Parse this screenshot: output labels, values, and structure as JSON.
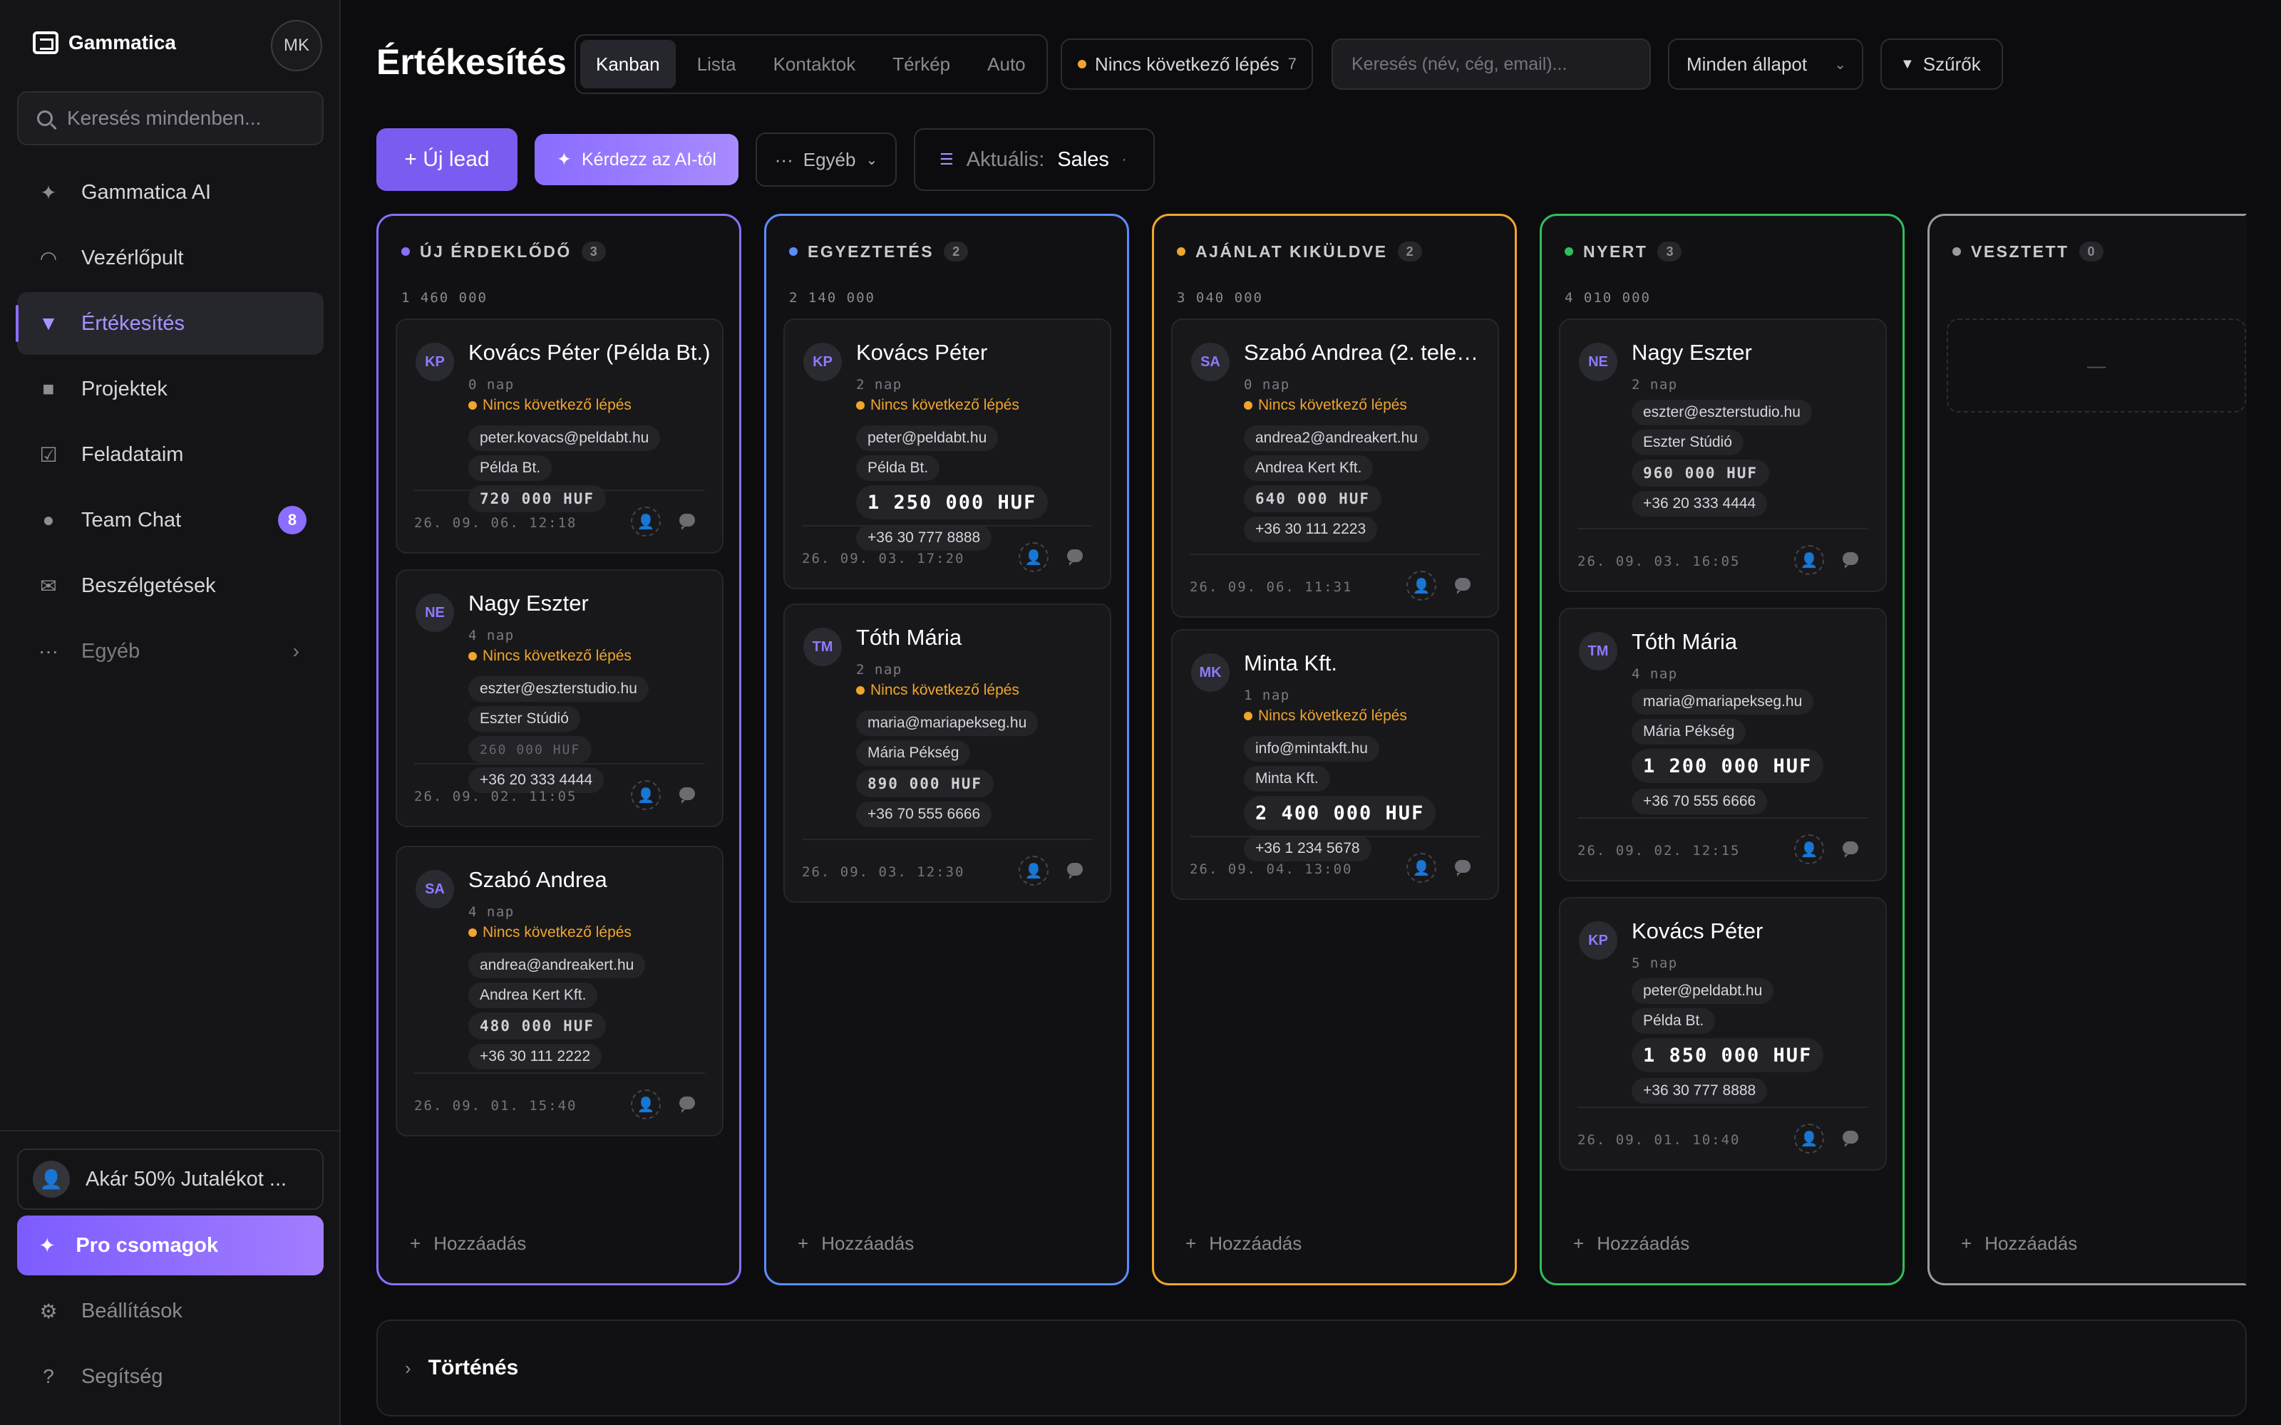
{
  "brand": {
    "name": "Gammatica",
    "user_initials": "MK"
  },
  "sidebar": {
    "search_placeholder": "Keresés mindenben...",
    "items": [
      {
        "label": "Gammatica AI",
        "icon": "sparkle-icon"
      },
      {
        "label": "Vezérlőpult",
        "icon": "dashboard-icon"
      },
      {
        "label": "Értékesítés",
        "icon": "funnel-icon",
        "active": true
      },
      {
        "label": "Projektek",
        "icon": "folder-icon"
      },
      {
        "label": "Feladataim",
        "icon": "checkbox-icon"
      },
      {
        "label": "Team Chat",
        "icon": "chat-icon",
        "badge": "8"
      },
      {
        "label": "Beszélgetések",
        "icon": "mail-icon"
      },
      {
        "label": "Egyéb",
        "icon": "more-icon"
      }
    ],
    "promo": "Akár 50% Jutalékot ...",
    "pro_label": "Pro csomagok",
    "settings_label": "Beállítások",
    "help_label": "Segítség"
  },
  "header": {
    "title": "Értékesítés",
    "tabs": [
      "Kanban",
      "Lista",
      "Kontaktok",
      "Térkép",
      "Auto"
    ],
    "next_step_filter": {
      "label": "Nincs következő lépés",
      "count": "7"
    },
    "search_placeholder": "Keresés (név, cég, email)...",
    "status_select": "Minden állapot",
    "filters_label": "Szűrők"
  },
  "actions": {
    "new_lead": "+ Új lead",
    "ask_ai": "Kérdezz az AI-tól",
    "other": "Egyéb",
    "current_label": "Aktuális:",
    "current_value": "Sales"
  },
  "columns": [
    {
      "title": "ÚJ ÉRDEKLŐDŐ",
      "count": "3",
      "sum": "1 460 000",
      "color": "#8b6dff",
      "cards": [
        {
          "initials": "KP",
          "name": "Kovács Péter (Példa Bt.)",
          "days": "0 nap",
          "next": "Nincs következő lépés",
          "email": "peter.kovacs@peldabt.hu",
          "company": "Példa Bt.",
          "amount": "720 000 HUF",
          "date": "26. 09. 06. 12:18"
        },
        {
          "initials": "NE",
          "name": "Nagy Eszter",
          "days": "4 nap",
          "next": "Nincs következő lépés",
          "email": "eszter@eszterstudio.hu",
          "company": "Eszter Stúdió",
          "amount": "260 000 HUF",
          "phone": "+36 20 333 4444",
          "date": "26. 09. 02. 11:05"
        },
        {
          "initials": "SA",
          "name": "Szabó Andrea",
          "days": "4 nap",
          "next": "Nincs következő lépés",
          "email": "andrea@andreakert.hu",
          "company": "Andrea Kert Kft.",
          "amount": "480 000 HUF",
          "phone": "+36 30 111 2222",
          "date": "26. 09. 01. 15:40"
        }
      ]
    },
    {
      "title": "EGYEZTETÉS",
      "count": "2",
      "sum": "2 140 000",
      "color": "#5b8cff",
      "cards": [
        {
          "initials": "KP",
          "name": "Kovács Péter",
          "days": "2 nap",
          "next": "Nincs következő lépés",
          "email": "peter@peldabt.hu",
          "company": "Példa Bt.",
          "amount": "1 250 000 HUF",
          "phone": "+36 30 777 8888",
          "date": "26. 09. 03. 17:20"
        },
        {
          "initials": "TM",
          "name": "Tóth Mária",
          "days": "2 nap",
          "next": "Nincs következő lépés",
          "email": "maria@mariapekseg.hu",
          "company": "Mária Pékség",
          "amount": "890 000 HUF",
          "phone": "+36 70 555 6666",
          "date": "26. 09. 03. 12:30"
        }
      ]
    },
    {
      "title": "AJÁNLAT KIKÜLDVE",
      "count": "2",
      "sum": "3 040 000",
      "color": "#f0a52c",
      "cards": [
        {
          "initials": "SA",
          "name": "Szabó Andrea (2. telep...",
          "days": "0 nap",
          "next": "Nincs következő lépés",
          "email": "andrea2@andreakert.hu",
          "company": "Andrea Kert Kft.",
          "amount": "640 000 HUF",
          "phone": "+36 30 111 2223",
          "date": "26. 09. 06. 11:31"
        },
        {
          "initials": "MK",
          "name": "Minta Kft.",
          "days": "1 nap",
          "next": "Nincs következő lépés",
          "email": "info@mintakft.hu",
          "company": "Minta Kft.",
          "amount": "2 400 000 HUF",
          "phone": "+36 1 234 5678",
          "date": "26. 09. 04. 13:00"
        }
      ]
    },
    {
      "title": "NYERT",
      "count": "3",
      "sum": "4 010 000",
      "color": "#2fbf5a",
      "cards": [
        {
          "initials": "NE",
          "name": "Nagy Eszter",
          "days": "2 nap",
          "email": "eszter@eszterstudio.hu",
          "company": "Eszter Stúdió",
          "amount": "960 000 HUF",
          "phone": "+36 20 333 4444",
          "date": "26. 09. 03. 16:05"
        },
        {
          "initials": "TM",
          "name": "Tóth Mária",
          "days": "4 nap",
          "email": "maria@mariapekseg.hu",
          "company": "Mária Pékség",
          "amount": "1 200 000 HUF",
          "phone": "+36 70 555 6666",
          "date": "26. 09. 02. 12:15"
        },
        {
          "initials": "KP",
          "name": "Kovács Péter",
          "days": "5 nap",
          "email": "peter@peldabt.hu",
          "company": "Példa Bt.",
          "amount": "1 850 000 HUF",
          "phone": "+36 30 777 8888",
          "date": "26. 09. 01. 10:40"
        }
      ]
    },
    {
      "title": "VESZTETT",
      "count": "0",
      "color": "#9a9aa2",
      "empty": "—",
      "cards": []
    }
  ],
  "add_label": "Hozzáadás",
  "history_label": "Történés"
}
